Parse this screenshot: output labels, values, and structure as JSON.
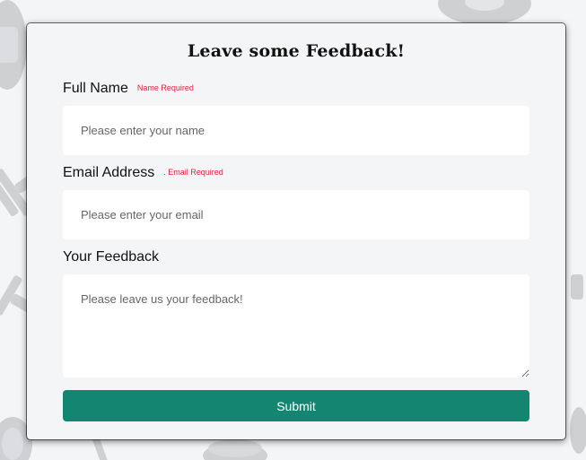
{
  "form": {
    "title": "Leave some Feedback!",
    "name_field": {
      "label": "Full Name",
      "required_note": "Name Required",
      "placeholder": "Please enter your name",
      "value": ""
    },
    "email_field": {
      "label": "Email Address",
      "required_note": ". Email Required",
      "placeholder": "Please enter your email",
      "value": ""
    },
    "feedback_field": {
      "label": "Your Feedback",
      "placeholder": "Please leave us your feedback!",
      "value": ""
    },
    "submit_label": "Submit"
  },
  "background": {
    "pattern_icon": "dumbbell-icon"
  },
  "colors": {
    "page_background": "#f4f5f7",
    "card_background": "#f4f5f7",
    "input_background": "#ffffff",
    "required_text": "#e0203a",
    "submit_button": "#148571",
    "submit_text": "#ffffff",
    "pattern": "#cfd0d2"
  }
}
